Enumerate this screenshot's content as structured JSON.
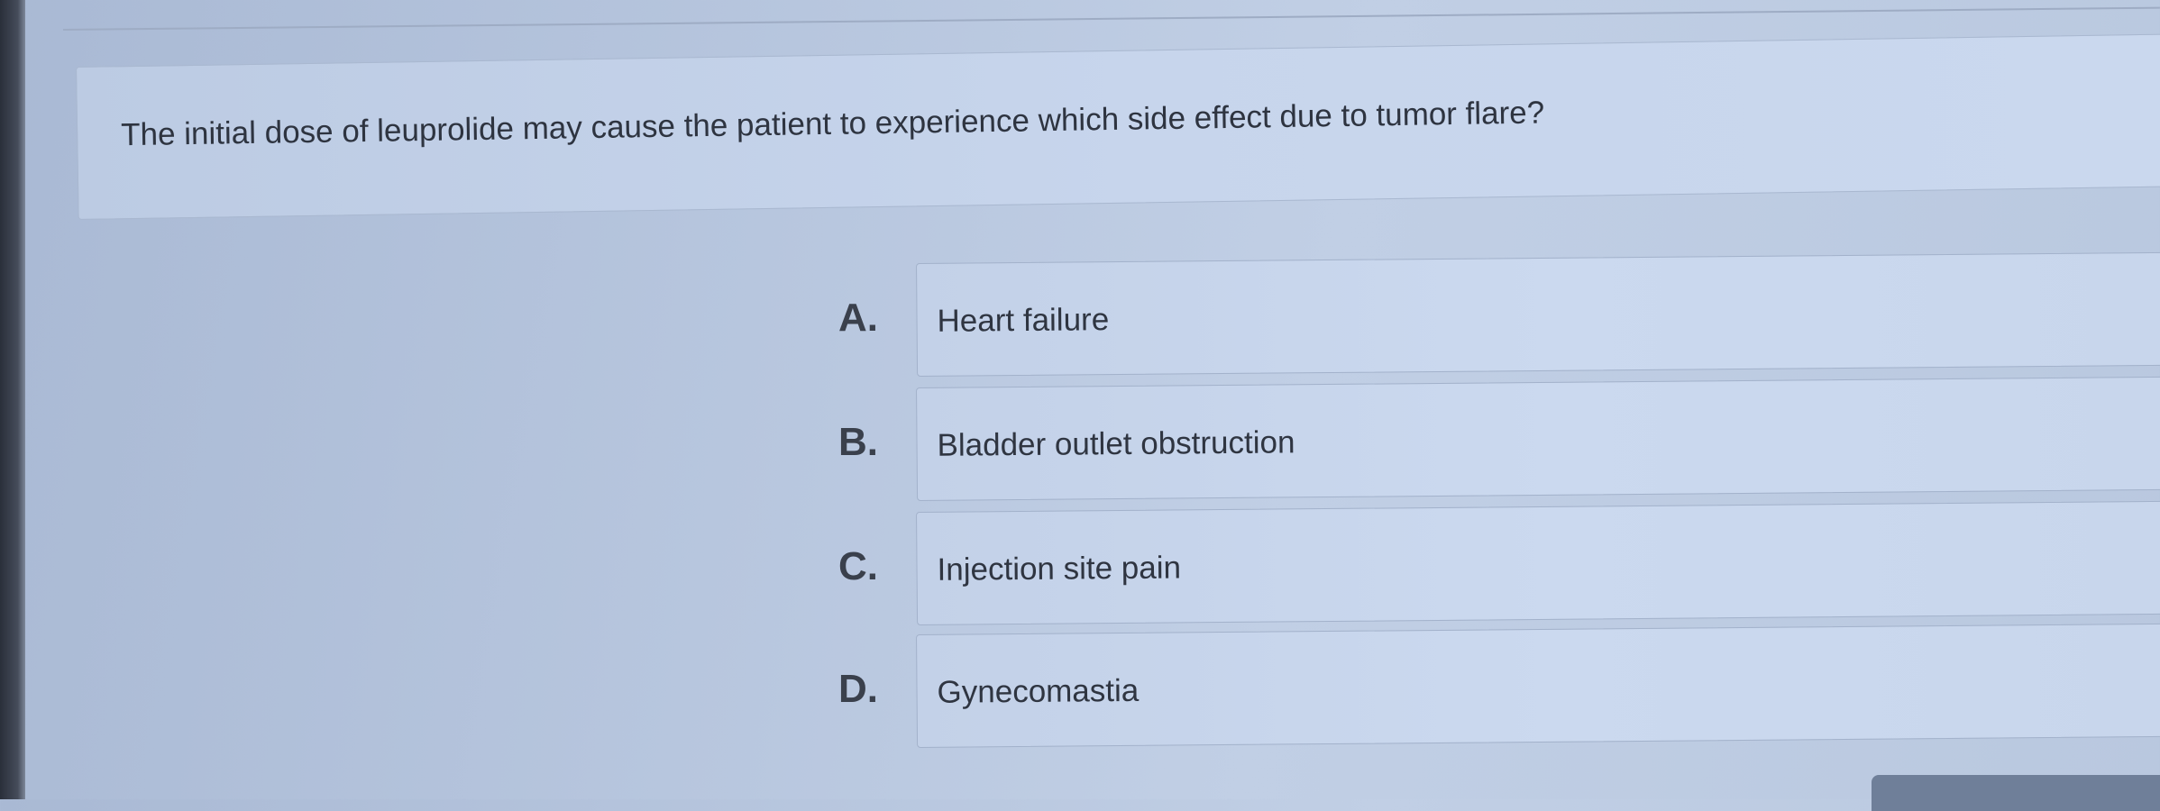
{
  "question": {
    "text": "The initial dose of leuprolide may cause the patient to experience which side effect due to tumor flare?"
  },
  "options": [
    {
      "letter": "A.",
      "text": "Heart failure"
    },
    {
      "letter": "B.",
      "text": "Bladder outlet obstruction"
    },
    {
      "letter": "C.",
      "text": "Injection site pain"
    },
    {
      "letter": "D.",
      "text": "Gynecomastia"
    }
  ]
}
